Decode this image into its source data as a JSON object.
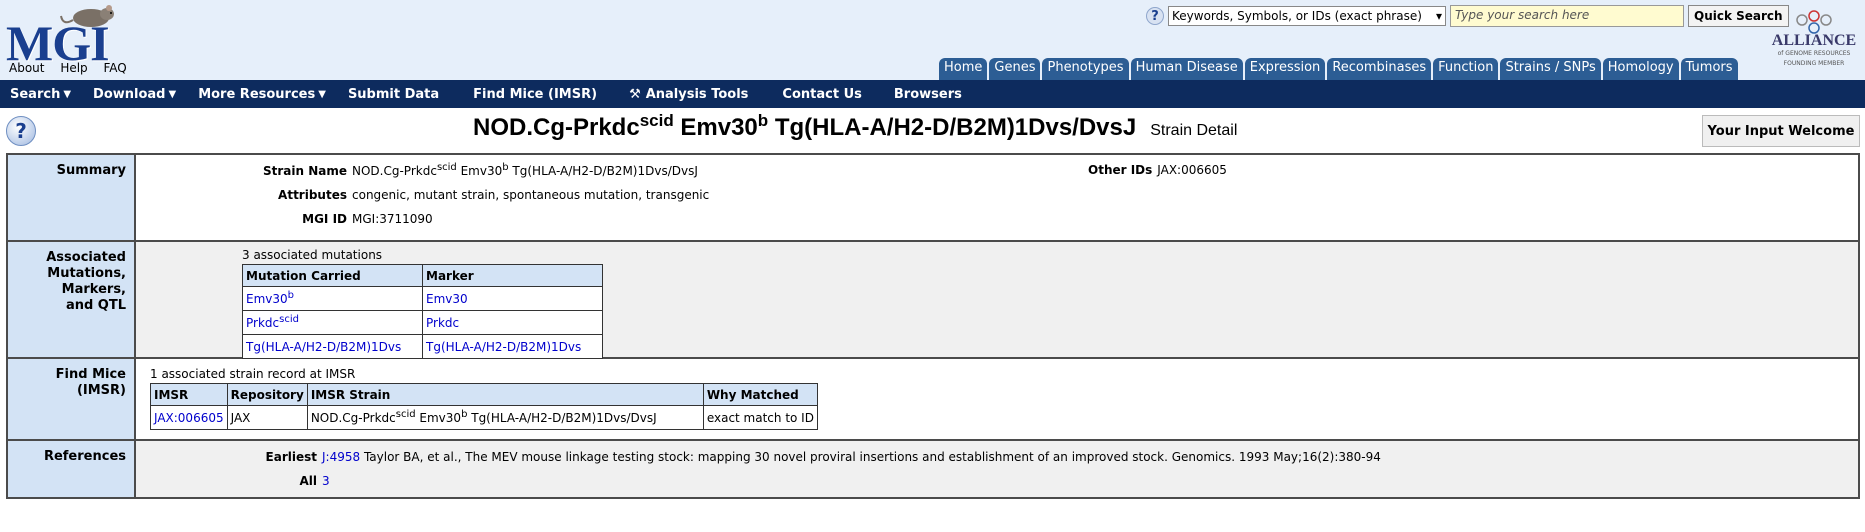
{
  "header": {
    "logo_text": "MGI",
    "links": [
      "About",
      "Help",
      "FAQ"
    ],
    "search_select_value": "Keywords, Symbols, or IDs (exact phrase)",
    "search_placeholder": "Type your search here",
    "quick_search_label": "Quick Search",
    "alliance": {
      "name": "ALLIANCE",
      "sub": "of GENOME RESOURCES",
      "sub2": "FOUNDING MEMBER"
    },
    "tabs": [
      "Home",
      "Genes",
      "Phenotypes",
      "Human Disease",
      "Expression",
      "Recombinases",
      "Function",
      "Strains / SNPs",
      "Homology",
      "Tumors"
    ]
  },
  "navbar": {
    "items": [
      "Search",
      "Download",
      "More Resources",
      "Submit Data",
      "Find Mice (IMSR)",
      "Analysis Tools",
      "Contact Us",
      "Browsers"
    ]
  },
  "title": {
    "part1": "NOD.Cg-Prkdc",
    "sup1": "scid",
    "part2": " Emv30",
    "sup2": "b",
    "part3": " Tg(HLA-A/H2-D/B2M)1Dvs/DvsJ",
    "subtitle": "Strain Detail",
    "feedback_label": "Your Input Welcome"
  },
  "summary": {
    "label": "Summary",
    "strain_name_label": "Strain Name",
    "strain_name": {
      "a": "NOD.Cg-Prkdc",
      "sup_a": "scid",
      "b": " Emv30",
      "sup_b": "b",
      "c": " Tg(HLA-A/H2-D/B2M)1Dvs/DvsJ"
    },
    "attributes_label": "Attributes",
    "attributes": "congenic, mutant strain, spontaneous mutation, transgenic",
    "mgi_id_label": "MGI ID",
    "mgi_id": "MGI:3711090",
    "other_ids_label": "Other IDs",
    "other_ids": "JAX:006605"
  },
  "mutations": {
    "label_lines": [
      "Associated",
      "Mutations,",
      "Markers,",
      "and QTL"
    ],
    "count_text": "3 associated mutations",
    "headers": [
      "Mutation Carried",
      "Marker"
    ],
    "rows": [
      {
        "mutation": "Emv30",
        "mutation_sup": "b",
        "marker": "Emv30"
      },
      {
        "mutation": "Prkdc",
        "mutation_sup": "scid",
        "marker": "Prkdc"
      },
      {
        "mutation": "Tg(HLA-A/H2-D/B2M)1Dvs",
        "mutation_sup": "",
        "marker": "Tg(HLA-A/H2-D/B2M)1Dvs"
      }
    ]
  },
  "imsr": {
    "label_lines": [
      "Find Mice",
      "(IMSR)"
    ],
    "count_text": "1 associated strain record at IMSR",
    "headers": [
      "IMSR",
      "Repository",
      "IMSR Strain",
      "Why Matched"
    ],
    "row": {
      "imsr": "JAX:006605",
      "repository": "JAX",
      "strain_a": "NOD.Cg-Prkdc",
      "strain_sup_a": "scid",
      "strain_b": " Emv30",
      "strain_sup_b": "b",
      "strain_c": " Tg(HLA-A/H2-D/B2M)1Dvs/DvsJ",
      "why": "exact match to ID"
    }
  },
  "references": {
    "label": "References",
    "earliest_label": "Earliest",
    "earliest_id": "J:4958",
    "earliest_text": " Taylor BA, et al., The MEV mouse linkage testing stock: mapping 30 novel proviral insertions and establishment of an improved stock. Genomics. 1993 May;16(2):380-94",
    "all_label": "All",
    "all_count": "3"
  }
}
